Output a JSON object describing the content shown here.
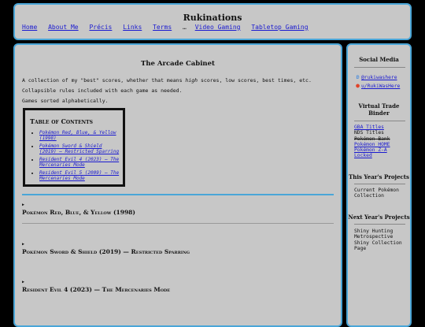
{
  "site": {
    "title": "Rukinations"
  },
  "nav": {
    "items": [
      "Home",
      "About Me",
      "Précis",
      "Links",
      "Terms"
    ],
    "separator": "…",
    "items2": [
      "Video Gaming",
      "Tabletop Gaming"
    ]
  },
  "page": {
    "title": "The Arcade Cabinet",
    "intro1_pre": "A collection of my \"best\" scores, whether that means ",
    "intro1_em": "high",
    "intro1_post": " scores, low scores, best times, etc.",
    "intro2": "Collapsible rules included with each game as needed.",
    "intro3": "Games sorted alphabetically."
  },
  "toc": {
    "title": "Table of Contents",
    "items": [
      "Pokémon Red, Blue, & Yellow (1998)",
      "Pokémon Sword & Shield (2019) — Restricted Sparring",
      "Resident Evil 4 (2023) — The Mercenaries Mode",
      "Resident Evil 5 (2009) — The Mercenaries Mode"
    ]
  },
  "sections": [
    {
      "marker": "▶",
      "title": "Pokémon Red, Blue, & Yellow (1998)"
    },
    {
      "marker": "▶",
      "title": "Pokémon Sword & Shield (2019) — Restricted Sparring"
    },
    {
      "marker": "▶",
      "title": "Resident Evil 4 (2023) — The Mercenaries Mode"
    }
  ],
  "sidebar": {
    "social_heading": "Social Media",
    "social": [
      {
        "icon": "butterfly-icon",
        "label": "@rukiwashere"
      },
      {
        "icon": "reddit-icon",
        "label": "u/RukiWasHere"
      }
    ],
    "binder_heading": "Virtual Trade Binder",
    "binder": [
      {
        "label": "GBA Titles",
        "link": true,
        "strike": false
      },
      {
        "label": "NDS Titles",
        "link": false,
        "strike": false
      },
      {
        "label": "Pokémon Bank",
        "link": false,
        "strike": true
      },
      {
        "label": "Pokémon HOME",
        "link": true,
        "strike": false
      },
      {
        "label": "Pokémon Z-A",
        "link": true,
        "strike": false
      },
      {
        "label": "Locked",
        "link": true,
        "strike": false
      }
    ],
    "this_year_heading": "This Year's Projects",
    "this_year": [
      "Current Pokémon",
      "Collection"
    ],
    "next_year_heading": "Next Year's Projects",
    "next_year": [
      "Shiny Hunting",
      "Metrospective",
      "Shiny Collection",
      "Page"
    ]
  },
  "colors": {
    "accent": "#4aa6d8",
    "panel": "#c7c7c7",
    "link": "#1a1ad0"
  }
}
